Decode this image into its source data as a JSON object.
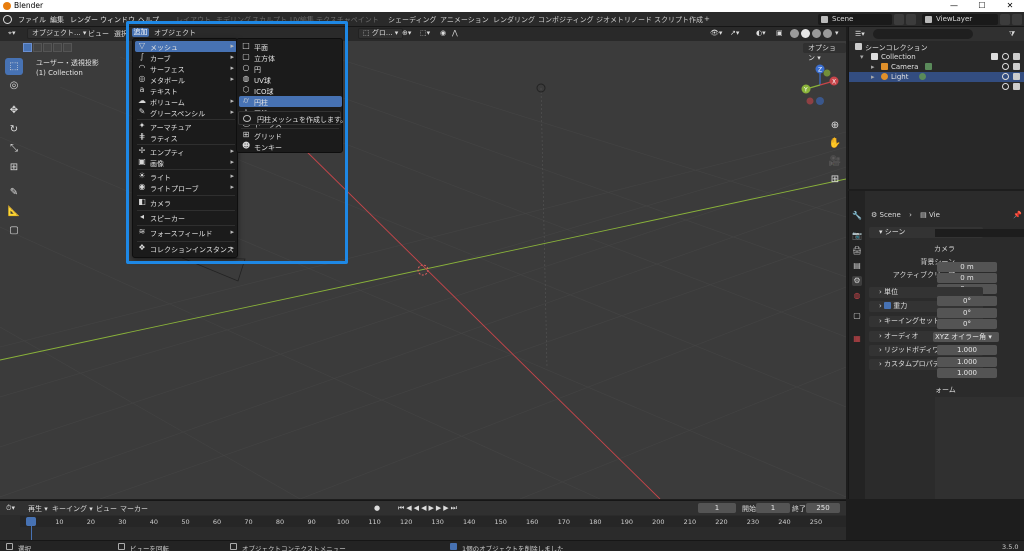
{
  "window": {
    "title": "Blender"
  },
  "menubar": {
    "items": [
      "ファイル",
      "編集",
      "レンダー",
      "ウィンドウ",
      "ヘルプ"
    ],
    "workspace_tabs": [
      "レイアウト",
      "モデリング",
      "スカルプト",
      "UV編集",
      "テクスチャペイント",
      "シェーディング",
      "アニメーション",
      "レンダリング",
      "コンポジティング",
      "ジオメトリノード",
      "スクリプト作成"
    ],
    "add_tab_label": "+",
    "scene": "Scene",
    "view_layer": "ViewLayer"
  },
  "viewport_header": {
    "mode": "オブジェクト...",
    "view": "ビュー",
    "select": "選択",
    "transform_orientation": "グロ...",
    "options_label": "オプション"
  },
  "viewport_info": {
    "view_name": "ユーザー・透視投影",
    "collection": "(1) Collection"
  },
  "menu_strip": {
    "add": "追加",
    "object": "オブジェクト"
  },
  "add_menu": {
    "items": [
      {
        "label": "メッシュ",
        "icon": "mesh-icon",
        "arrow": true,
        "highlighted": true
      },
      {
        "label": "カーブ",
        "icon": "curve-icon",
        "arrow": true
      },
      {
        "label": "サーフェス",
        "icon": "surface-icon",
        "arrow": true
      },
      {
        "label": "メタボール",
        "icon": "metaball-icon",
        "arrow": true
      },
      {
        "label": "テキスト",
        "icon": "text-icon",
        "arrow": false
      },
      {
        "label": "ボリューム",
        "icon": "volume-icon",
        "arrow": true
      },
      {
        "label": "グリースペンシル",
        "icon": "grease-pencil-icon",
        "arrow": true
      },
      {
        "label": "アーマチュア",
        "icon": "armature-icon",
        "arrow": false
      },
      {
        "label": "ラティス",
        "icon": "lattice-icon",
        "arrow": false
      },
      {
        "label": "エンプティ",
        "icon": "empty-icon",
        "arrow": true
      },
      {
        "label": "画像",
        "icon": "image-icon",
        "arrow": true
      },
      {
        "label": "ライト",
        "icon": "light-icon",
        "arrow": true
      },
      {
        "label": "ライトプローブ",
        "icon": "light-probe-icon",
        "arrow": true
      },
      {
        "label": "カメラ",
        "icon": "camera-icon",
        "arrow": false
      },
      {
        "label": "スピーカー",
        "icon": "speaker-icon",
        "arrow": false
      },
      {
        "label": "フォースフィールド",
        "icon": "force-field-icon",
        "arrow": true
      },
      {
        "label": "コレクションインスタンス",
        "icon": "collection-instance-icon",
        "arrow": true
      }
    ]
  },
  "mesh_menu": {
    "items": [
      {
        "label": "平面",
        "icon": "plane-icon"
      },
      {
        "label": "立方体",
        "icon": "cube-icon"
      },
      {
        "label": "円",
        "icon": "circle-icon"
      },
      {
        "label": "UV球",
        "icon": "uv-sphere-icon"
      },
      {
        "label": "ICO球",
        "icon": "ico-sphere-icon"
      },
      {
        "label": "円柱",
        "icon": "cylinder-icon",
        "highlighted": true
      },
      {
        "label": "円錐",
        "icon": "cone-icon"
      },
      {
        "label": "トーラス",
        "icon": "torus-icon"
      },
      {
        "label": "グリッド",
        "icon": "grid-icon"
      },
      {
        "label": "モンキー",
        "icon": "monkey-icon"
      }
    ],
    "tooltip": "円柱メッシュを作成します。"
  },
  "outliner": {
    "title": "シーンコレクション",
    "rows": [
      {
        "label": "Collection",
        "level": 1
      },
      {
        "label": "Camera",
        "level": 2
      },
      {
        "label": "Light",
        "level": 2
      }
    ]
  },
  "properties": {
    "scene_breadcrumb": "Scene",
    "breadcrumb_child": "Vie",
    "section_scene": "シーン",
    "fields": [
      {
        "label": "カメラ",
        "value": ""
      },
      {
        "label": "背景シーン",
        "value": ""
      },
      {
        "label": "アクティブクリップ",
        "value": ""
      }
    ],
    "gravity_values": [
      "0 m",
      "0 m",
      "0 m"
    ],
    "sections": [
      "単位",
      "重力",
      "キーイングセット",
      "オーディオ",
      "リジッドボディワー...",
      "カスタムプロパティ"
    ],
    "angle_values": [
      "0°",
      "0°",
      "0°"
    ],
    "rotation_mode": "XYZ オイラー角",
    "scale_values": [
      "1.000",
      "1.000",
      "1.000"
    ],
    "transform_partial": "ォーム"
  },
  "timeline": {
    "playback": "再生",
    "keying": "キーイング",
    "view": "ビュー",
    "marker": "マーカー",
    "current_frame": "1",
    "start_label": "開始",
    "start": "1",
    "end_label": "終了",
    "end": "250",
    "ticks": [
      "1",
      "10",
      "20",
      "30",
      "40",
      "50",
      "60",
      "70",
      "80",
      "90",
      "100",
      "110",
      "120",
      "130",
      "140",
      "150",
      "160",
      "170",
      "180",
      "190",
      "200",
      "210",
      "220",
      "230",
      "240",
      "250"
    ]
  },
  "statusbar": {
    "select": "選択",
    "rotate_view": "ビューを回転",
    "context_menu": "オブジェクトコンテクストメニュー",
    "message": "1個のオブジェクトを削除しました",
    "version": "3.5.0"
  },
  "colors": {
    "accent": "#4772b3",
    "highlight_box": "#1e88e5",
    "x_axis": "#c8454a",
    "y_axis": "#8ab33a"
  }
}
